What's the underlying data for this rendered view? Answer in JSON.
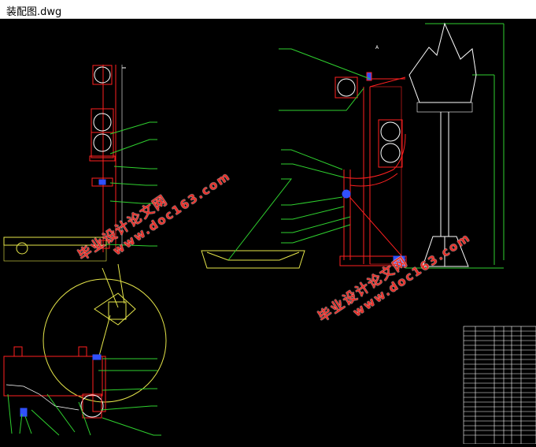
{
  "window": {
    "title": "装配图.dwg"
  },
  "drawing": {
    "label_a": "A"
  },
  "watermarks": [
    {
      "line1": "毕业设计论文网",
      "line2": "www.doc163.com"
    },
    {
      "line1": "毕业设计论文网",
      "line2": "www.doc163.com"
    }
  ],
  "colors": {
    "background": "#000000",
    "red": "#ff2020",
    "green": "#2fd12f",
    "yellow": "#e6e64a",
    "white": "#ffffff",
    "blue": "#3050ff",
    "watermark": "#e8302a"
  }
}
